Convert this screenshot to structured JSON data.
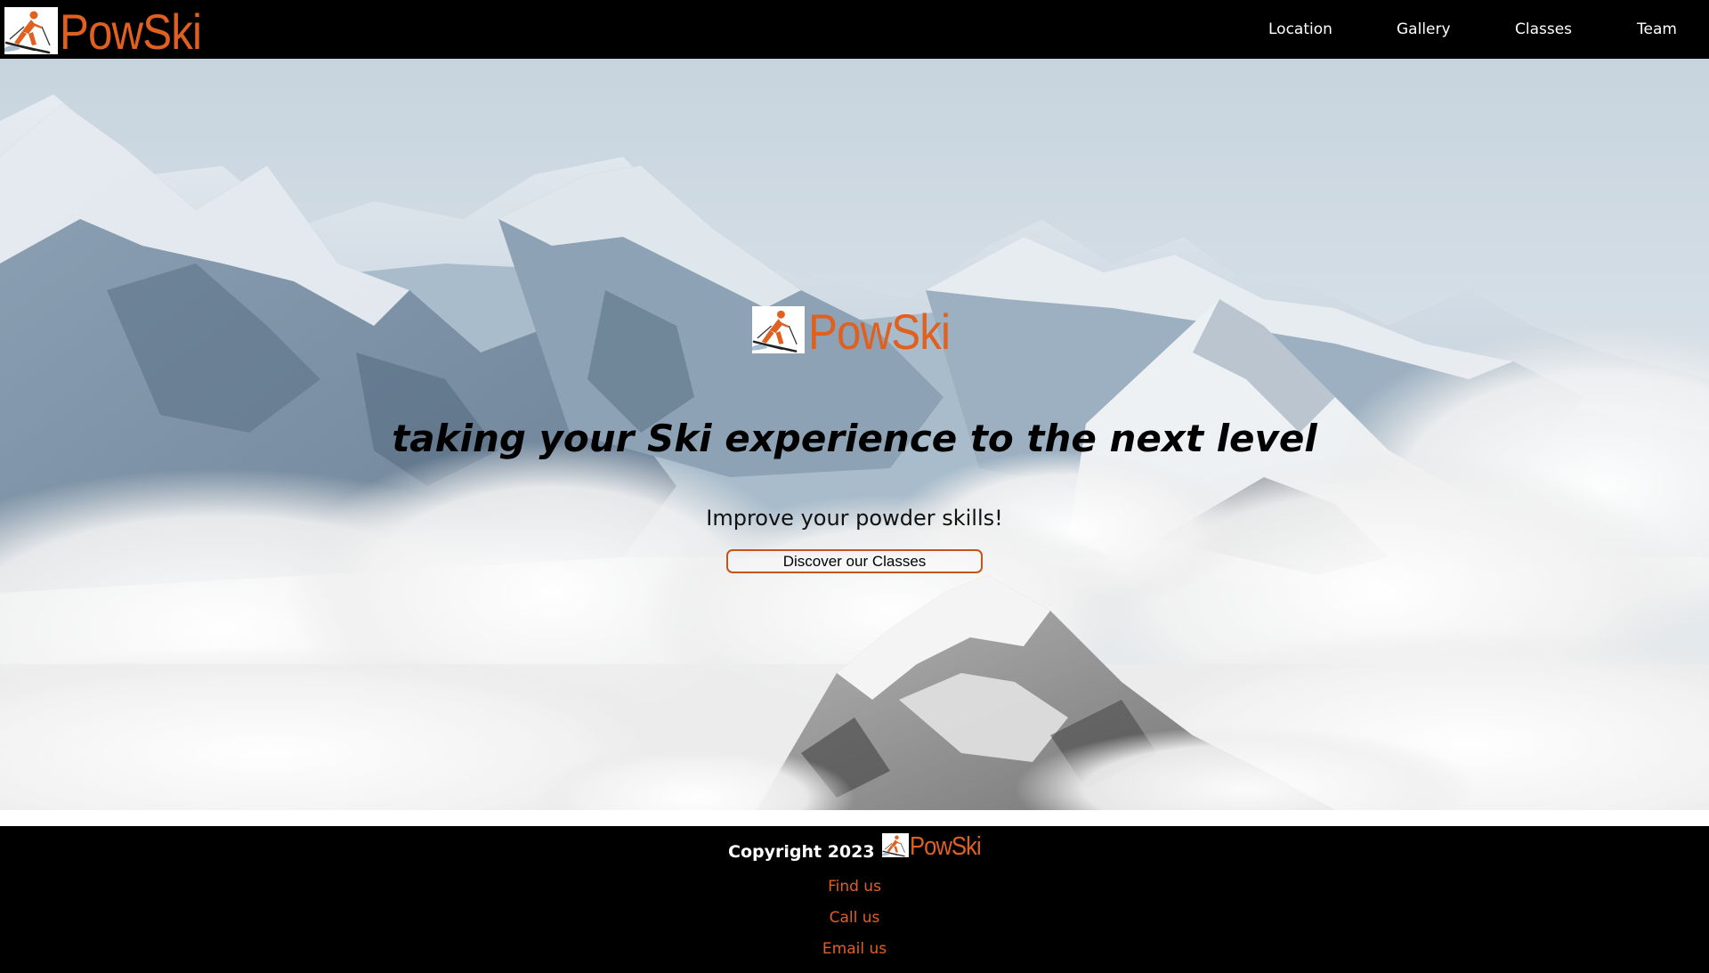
{
  "brand": {
    "name": "PowSki",
    "logo_icon": "skier-icon",
    "accent_color": "#e06020"
  },
  "nav": {
    "links": [
      {
        "label": "Location"
      },
      {
        "label": "Gallery"
      },
      {
        "label": "Classes"
      },
      {
        "label": "Team"
      }
    ]
  },
  "hero": {
    "tagline": "taking your Ski experience to the next level",
    "subtitle": "Improve your powder skills!",
    "cta_label": "Discover our Classes"
  },
  "footer": {
    "copyright": "Copyright 2023",
    "links": [
      {
        "label": "Find us"
      },
      {
        "label": "Call us"
      },
      {
        "label": "Email us"
      }
    ]
  }
}
